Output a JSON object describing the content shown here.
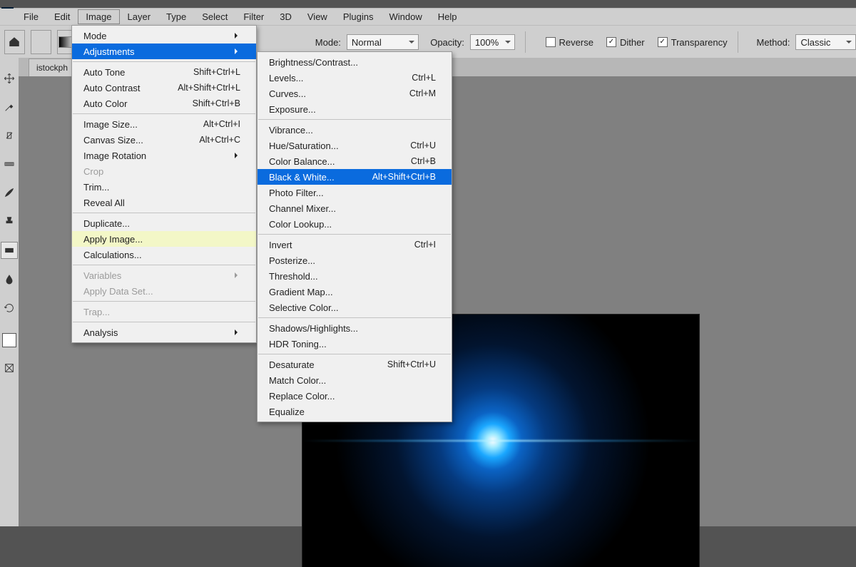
{
  "menubar": {
    "items": [
      "File",
      "Edit",
      "Image",
      "Layer",
      "Type",
      "Select",
      "Filter",
      "3D",
      "View",
      "Plugins",
      "Window",
      "Help"
    ],
    "open_index": 2
  },
  "optionsbar": {
    "mode_label": "Mode:",
    "mode_value": "Normal",
    "opacity_label": "Opacity:",
    "opacity_value": "100%",
    "reverse_label": "Reverse",
    "reverse_checked": false,
    "dither_label": "Dither",
    "dither_checked": true,
    "transparency_label": "Transparency",
    "transparency_checked": true,
    "method_label": "Method:",
    "method_value": "Classic"
  },
  "document": {
    "tab_name": "istockph"
  },
  "image_menu": [
    {
      "type": "item",
      "label": "Mode",
      "arrow": true
    },
    {
      "type": "item",
      "label": "Adjustments",
      "arrow": true,
      "selected": true
    },
    {
      "type": "sep"
    },
    {
      "type": "item",
      "label": "Auto Tone",
      "short": "Shift+Ctrl+L"
    },
    {
      "type": "item",
      "label": "Auto Contrast",
      "short": "Alt+Shift+Ctrl+L"
    },
    {
      "type": "item",
      "label": "Auto Color",
      "short": "Shift+Ctrl+B"
    },
    {
      "type": "sep"
    },
    {
      "type": "item",
      "label": "Image Size...",
      "short": "Alt+Ctrl+I"
    },
    {
      "type": "item",
      "label": "Canvas Size...",
      "short": "Alt+Ctrl+C"
    },
    {
      "type": "item",
      "label": "Image Rotation",
      "arrow": true
    },
    {
      "type": "item",
      "label": "Crop",
      "disabled": true
    },
    {
      "type": "item",
      "label": "Trim..."
    },
    {
      "type": "item",
      "label": "Reveal All"
    },
    {
      "type": "sep"
    },
    {
      "type": "item",
      "label": "Duplicate..."
    },
    {
      "type": "item",
      "label": "Apply Image...",
      "hover": true
    },
    {
      "type": "item",
      "label": "Calculations..."
    },
    {
      "type": "sep"
    },
    {
      "type": "item",
      "label": "Variables",
      "arrow": true,
      "disabled": true
    },
    {
      "type": "item",
      "label": "Apply Data Set...",
      "disabled": true
    },
    {
      "type": "sep"
    },
    {
      "type": "item",
      "label": "Trap...",
      "disabled": true
    },
    {
      "type": "sep"
    },
    {
      "type": "item",
      "label": "Analysis",
      "arrow": true
    }
  ],
  "adjust_menu": [
    {
      "type": "item",
      "label": "Brightness/Contrast..."
    },
    {
      "type": "item",
      "label": "Levels...",
      "short": "Ctrl+L"
    },
    {
      "type": "item",
      "label": "Curves...",
      "short": "Ctrl+M"
    },
    {
      "type": "item",
      "label": "Exposure..."
    },
    {
      "type": "sep"
    },
    {
      "type": "item",
      "label": "Vibrance..."
    },
    {
      "type": "item",
      "label": "Hue/Saturation...",
      "short": "Ctrl+U"
    },
    {
      "type": "item",
      "label": "Color Balance...",
      "short": "Ctrl+B"
    },
    {
      "type": "item",
      "label": "Black & White...",
      "short": "Alt+Shift+Ctrl+B",
      "selected": true
    },
    {
      "type": "item",
      "label": "Photo Filter..."
    },
    {
      "type": "item",
      "label": "Channel Mixer..."
    },
    {
      "type": "item",
      "label": "Color Lookup..."
    },
    {
      "type": "sep"
    },
    {
      "type": "item",
      "label": "Invert",
      "short": "Ctrl+I"
    },
    {
      "type": "item",
      "label": "Posterize..."
    },
    {
      "type": "item",
      "label": "Threshold..."
    },
    {
      "type": "item",
      "label": "Gradient Map..."
    },
    {
      "type": "item",
      "label": "Selective Color..."
    },
    {
      "type": "sep"
    },
    {
      "type": "item",
      "label": "Shadows/Highlights..."
    },
    {
      "type": "item",
      "label": "HDR Toning..."
    },
    {
      "type": "sep"
    },
    {
      "type": "item",
      "label": "Desaturate",
      "short": "Shift+Ctrl+U"
    },
    {
      "type": "item",
      "label": "Match Color..."
    },
    {
      "type": "item",
      "label": "Replace Color..."
    },
    {
      "type": "item",
      "label": "Equalize"
    }
  ],
  "toolbar_icons": [
    "move",
    "eyedropper",
    "brush-edit",
    "ruler",
    "paintbrush",
    "stamp",
    "gradient",
    "blur",
    "rotate",
    "swatches",
    "frame"
  ]
}
